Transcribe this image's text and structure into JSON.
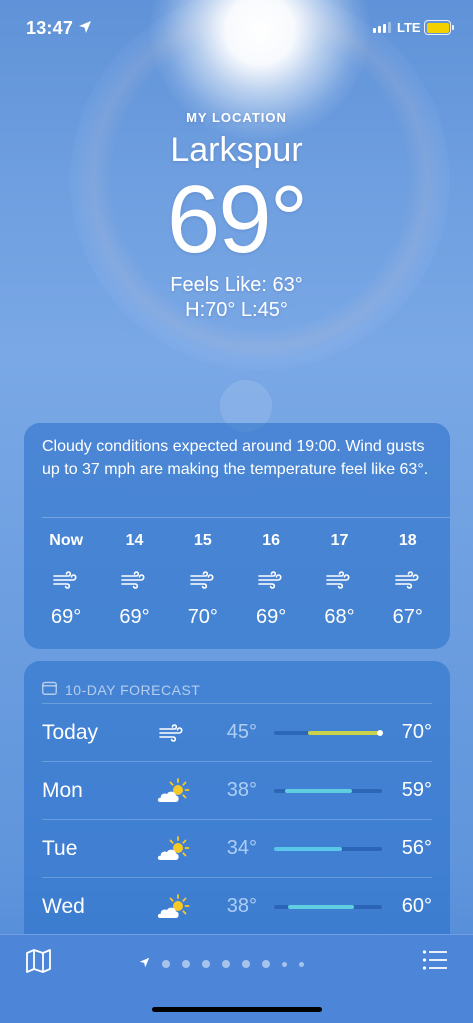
{
  "status_bar": {
    "time": "13:47",
    "network": "LTE",
    "battery_color": "#f5d000"
  },
  "header": {
    "label": "MY LOCATION",
    "city": "Larkspur",
    "temperature": "69°",
    "feels_like": "Feels Like: 63°",
    "high_low": "H:70°  L:45°"
  },
  "hourly": {
    "summary": "Cloudy conditions expected around 19:00. Wind gusts up to 37 mph are making the temperature feel like 63°.",
    "hours": [
      {
        "label": "Now",
        "icon": "wind-icon",
        "temp": "69°"
      },
      {
        "label": "14",
        "icon": "wind-icon",
        "temp": "69°"
      },
      {
        "label": "15",
        "icon": "wind-icon",
        "temp": "70°"
      },
      {
        "label": "16",
        "icon": "wind-icon",
        "temp": "69°"
      },
      {
        "label": "17",
        "icon": "wind-icon",
        "temp": "68°"
      },
      {
        "label": "18",
        "icon": "wind-icon",
        "temp": "67°"
      }
    ]
  },
  "forecast": {
    "title": "10-DAY FORECAST",
    "days": [
      {
        "day": "Today",
        "icon": "wind-icon",
        "low": "45°",
        "high": "70°",
        "range_start": 0.32,
        "range_end": 0.98,
        "bar_color": "#c9d24a",
        "current": true
      },
      {
        "day": "Mon",
        "icon": "partly-sunny-icon",
        "low": "38°",
        "high": "59°",
        "range_start": 0.1,
        "range_end": 0.72,
        "bar_color": "#5fcfe0",
        "current": false
      },
      {
        "day": "Tue",
        "icon": "partly-sunny-icon",
        "low": "34°",
        "high": "56°",
        "range_start": 0.0,
        "range_end": 0.63,
        "bar_color": "#59c8e8",
        "current": false
      },
      {
        "day": "Wed",
        "icon": "partly-sunny-icon",
        "low": "38°",
        "high": "60°",
        "range_start": 0.13,
        "range_end": 0.74,
        "bar_color": "#5fcfe0",
        "current": false
      }
    ]
  },
  "bottom_bar": {
    "page_count": 9,
    "current_page": 0
  }
}
